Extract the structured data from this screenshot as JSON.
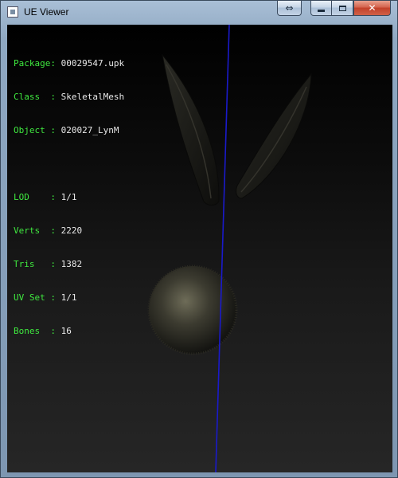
{
  "window": {
    "title": "UE Viewer",
    "buttons": {
      "resize": "⇔",
      "close": "✕"
    }
  },
  "info_panel": {
    "group1": [
      {
        "key": "Package",
        "value": "00029547.upk"
      },
      {
        "key": "Class  ",
        "value": "SkeletalMesh"
      },
      {
        "key": "Object ",
        "value": "020027_LynM"
      }
    ],
    "group2": [
      {
        "key": "LOD    ",
        "value": "1/1"
      },
      {
        "key": "Verts  ",
        "value": "2220"
      },
      {
        "key": "Tris   ",
        "value": "1382"
      },
      {
        "key": "UV Set ",
        "value": "1/1"
      },
      {
        "key": "Bones  ",
        "value": "16"
      }
    ]
  },
  "colors": {
    "label": "#3fe83f",
    "value": "#e9e9e9",
    "axis_line": "#1a1acc",
    "viewport_bg": "#000000"
  }
}
